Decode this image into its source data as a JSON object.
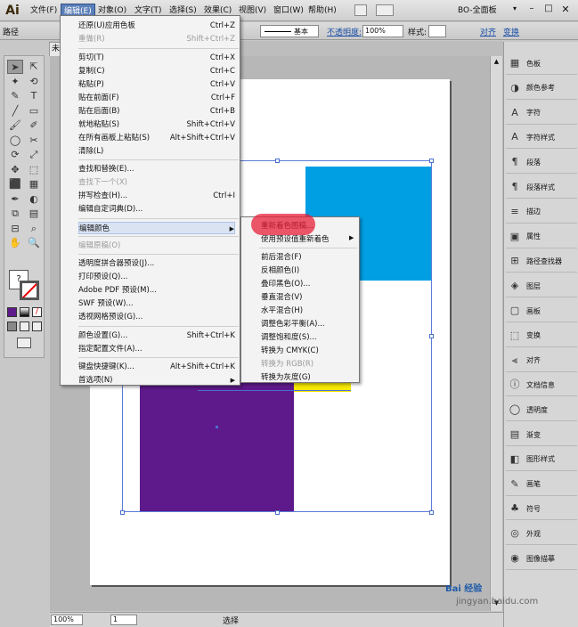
{
  "app": {
    "logo": "Ai",
    "workspace_label": "BO-全面板"
  },
  "menubar": [
    {
      "label": "文件(F)",
      "active": false
    },
    {
      "label": "编辑(E)",
      "active": true
    },
    {
      "label": "对象(O)",
      "active": false
    },
    {
      "label": "文字(T)",
      "active": false
    },
    {
      "label": "选择(S)",
      "active": false
    },
    {
      "label": "效果(C)",
      "active": false
    },
    {
      "label": "视图(V)",
      "active": false
    },
    {
      "label": "窗口(W)",
      "active": false
    },
    {
      "label": "帮助(H)",
      "active": false
    }
  ],
  "control_bar": {
    "left_label": "路径",
    "stroke_style": "基本",
    "opacity_label": "不透明度:",
    "opacity_value": "100%",
    "style_label": "样式:",
    "align_link": "对齐",
    "transform_link": "变换"
  },
  "doc_tab": {
    "label": "未"
  },
  "edit_menu": {
    "items": [
      {
        "label": "还原(U)应用色板",
        "shortcut": "Ctrl+Z",
        "disabled": false
      },
      {
        "label": "重做(R)",
        "shortcut": "Shift+Ctrl+Z",
        "disabled": true
      },
      {
        "label": "剪切(T)",
        "shortcut": "Ctrl+X",
        "disabled": false
      },
      {
        "label": "复制(C)",
        "shortcut": "Ctrl+C",
        "disabled": false
      },
      {
        "label": "粘贴(P)",
        "shortcut": "Ctrl+V",
        "disabled": false
      },
      {
        "label": "贴在前面(F)",
        "shortcut": "Ctrl+F",
        "disabled": false
      },
      {
        "label": "贴在后面(B)",
        "shortcut": "Ctrl+B",
        "disabled": false
      },
      {
        "label": "就地粘贴(S)",
        "shortcut": "Shift+Ctrl+V",
        "disabled": false
      },
      {
        "label": "在所有画板上粘贴(S)",
        "shortcut": "Alt+Shift+Ctrl+V",
        "disabled": false
      },
      {
        "label": "清除(L)",
        "shortcut": "",
        "disabled": false
      },
      {
        "label": "查找和替换(E)...",
        "shortcut": "",
        "disabled": false
      },
      {
        "label": "查找下一个(X)",
        "shortcut": "",
        "disabled": true
      },
      {
        "label": "拼写检查(H)...",
        "shortcut": "Ctrl+I",
        "disabled": false
      },
      {
        "label": "编辑自定词典(D)...",
        "shortcut": "",
        "disabled": false
      },
      {
        "label": "编辑颜色",
        "shortcut": "",
        "disabled": false
      },
      {
        "label": "编辑原稿(O)",
        "shortcut": "",
        "disabled": true
      },
      {
        "label": "透明度拼合器预设(J)...",
        "shortcut": "",
        "disabled": false
      },
      {
        "label": "打印预设(Q)...",
        "shortcut": "",
        "disabled": false
      },
      {
        "label": "Adobe PDF 预设(M)...",
        "shortcut": "",
        "disabled": false
      },
      {
        "label": "SWF 预设(W)...",
        "shortcut": "",
        "disabled": false
      },
      {
        "label": "透视网格预设(G)...",
        "shortcut": "",
        "disabled": false
      },
      {
        "label": "颜色设置(G)...",
        "shortcut": "Shift+Ctrl+K",
        "disabled": false
      },
      {
        "label": "指定配置文件(A)...",
        "shortcut": "",
        "disabled": false
      },
      {
        "label": "键盘快捷键(K)...",
        "shortcut": "Alt+Shift+Ctrl+K",
        "disabled": false
      },
      {
        "label": "首选项(N)",
        "shortcut": "",
        "disabled": false
      }
    ]
  },
  "color_submenu": {
    "items": [
      {
        "label": "重新着色图稿...",
        "disabled": false
      },
      {
        "label": "使用预设值重新着色",
        "disabled": false
      },
      {
        "label": "前后混合(F)",
        "disabled": false
      },
      {
        "label": "反相颜色(I)",
        "disabled": false
      },
      {
        "label": "叠印黑色(O)...",
        "disabled": false
      },
      {
        "label": "垂直混合(V)",
        "disabled": false
      },
      {
        "label": "水平混合(H)",
        "disabled": false
      },
      {
        "label": "调整色彩平衡(A)...",
        "disabled": false
      },
      {
        "label": "调整饱和度(S)...",
        "disabled": false
      },
      {
        "label": "转换为 CMYK(C)",
        "disabled": false
      },
      {
        "label": "转换为 RGB(R)",
        "disabled": true
      },
      {
        "label": "转换为灰度(G)",
        "disabled": false
      }
    ]
  },
  "shapes": {
    "blue": "#009fe3",
    "purple": "#5e1a8a",
    "yellow": "#f5e800",
    "selection": "#4b6fd0",
    "highlight": "#e8203a"
  },
  "panels": [
    {
      "label": "色板",
      "icon": "swatches-icon"
    },
    {
      "label": "颜色参考",
      "icon": "color-guide-icon"
    },
    {
      "label": "字符",
      "icon": "character-icon"
    },
    {
      "label": "字符样式",
      "icon": "character-styles-icon"
    },
    {
      "label": "段落",
      "icon": "paragraph-icon"
    },
    {
      "label": "段落样式",
      "icon": "paragraph-styles-icon"
    },
    {
      "label": "描边",
      "icon": "stroke-icon"
    },
    {
      "label": "属性",
      "icon": "attributes-icon"
    },
    {
      "label": "路径查找器",
      "icon": "pathfinder-icon"
    },
    {
      "label": "图层",
      "icon": "layers-icon"
    },
    {
      "label": "画板",
      "icon": "artboards-icon"
    },
    {
      "label": "变换",
      "icon": "transform-icon"
    },
    {
      "label": "对齐",
      "icon": "align-icon"
    },
    {
      "label": "文档信息",
      "icon": "document-info-icon"
    },
    {
      "label": "透明度",
      "icon": "transparency-icon"
    },
    {
      "label": "渐变",
      "icon": "gradient-icon"
    },
    {
      "label": "图形样式",
      "icon": "graphic-styles-icon"
    },
    {
      "label": "画笔",
      "icon": "brushes-icon"
    },
    {
      "label": "符号",
      "icon": "symbols-icon"
    },
    {
      "label": "外观",
      "icon": "appearance-icon"
    },
    {
      "label": "图像描摹",
      "icon": "image-trace-icon"
    }
  ],
  "statusbar": {
    "zoom": "100%",
    "page": "1",
    "tool": "选择"
  },
  "watermark": {
    "text": "jingyan.baidu.com",
    "brand": "Bai 经验"
  }
}
